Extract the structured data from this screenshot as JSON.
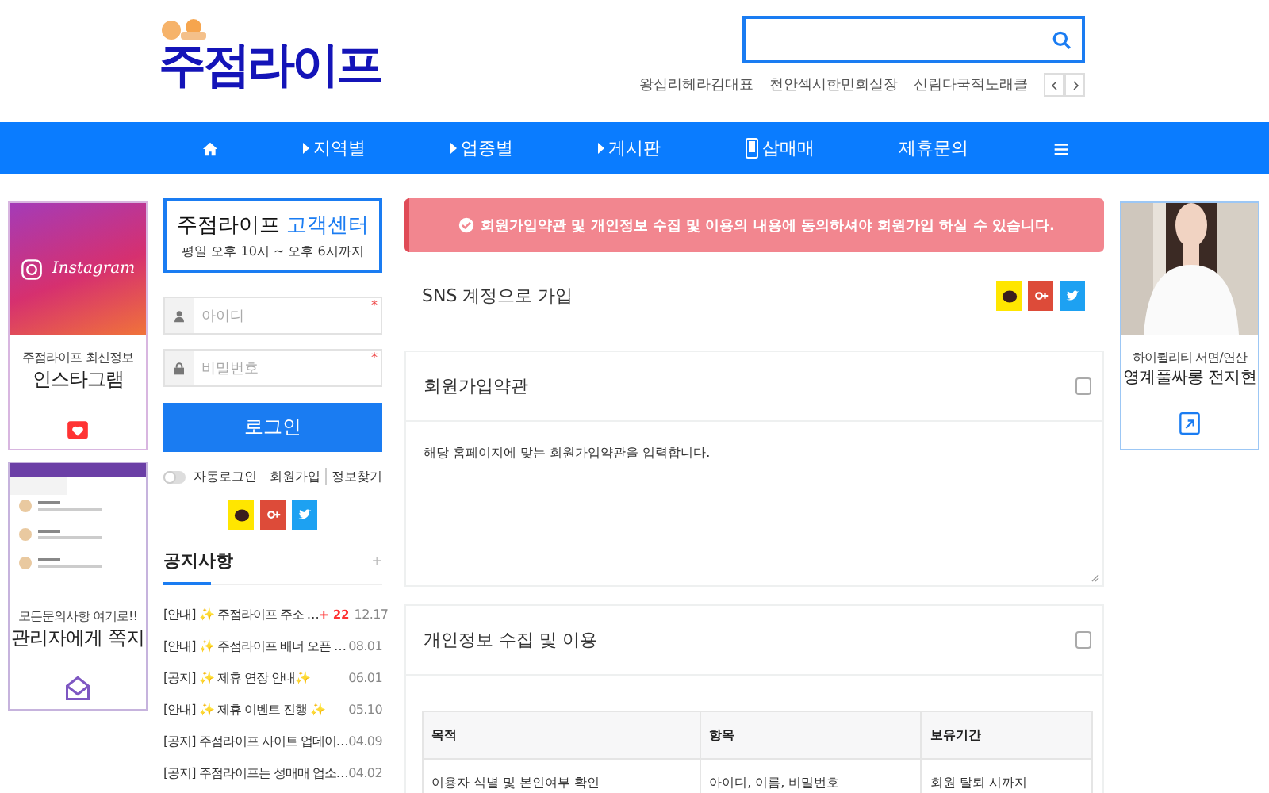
{
  "header": {
    "logo": "주점라이프",
    "keywords": [
      "왕십리헤라김대표",
      "천안섹시한민회실장",
      "신림다국적노래클"
    ]
  },
  "nav": [
    {
      "kind": "home"
    },
    {
      "kind": "caret",
      "label": "지역별"
    },
    {
      "kind": "caret",
      "label": "업종별"
    },
    {
      "kind": "caret",
      "label": "게시판"
    },
    {
      "kind": "phone",
      "label": "삽매매"
    },
    {
      "kind": "plain",
      "label": "제휴문의"
    },
    {
      "kind": "menu"
    }
  ],
  "left_banners": [
    {
      "kind": "instagram",
      "brand": "Instagram",
      "subtitle": "주점라이프 최신정보",
      "title": "인스타그램"
    },
    {
      "kind": "message",
      "subtitle": "모든문의사항 여기로!!",
      "title": "관리자에게 쪽지"
    }
  ],
  "login": {
    "center_name": "주점라이프",
    "center_label": "고객센터",
    "hours": "평일 오후 10시 ~ 오후 6시까지",
    "id_placeholder": "아이디",
    "pw_placeholder": "비밀번호",
    "required_mark": "*",
    "button": "로그인",
    "auto_login": {
      "label": "자동로그인",
      "on": false
    },
    "links": [
      "회원가입",
      "정보찾기"
    ]
  },
  "notices": {
    "title": "공지사항",
    "more": "+",
    "items": [
      {
        "tag": "[안내]",
        "title": "✨ 주점라이프 주소 …",
        "badge": "+ 22",
        "date": "12.17"
      },
      {
        "tag": "[안내]",
        "title": "✨ 주점라이프 배너 오픈 …",
        "date": "08.01"
      },
      {
        "tag": "[공지]",
        "title": "✨ 제휴 연장 안내✨",
        "date": "06.01"
      },
      {
        "tag": "[안내]",
        "title": "✨ 제휴 이벤트 진행 ✨",
        "date": "05.10"
      },
      {
        "tag": "[공지]",
        "title": "주점라이프 사이트 업데이…",
        "date": "04.09"
      },
      {
        "tag": "[공지]",
        "title": "주점라이프는 성매매 업소…",
        "date": "04.02"
      }
    ]
  },
  "alert": "회원가입약관 및 개인정보 수집 및 이용의 내용에 동의하셔야 회원가입 하실 수 있습니다.",
  "sns_join": "SNS 계정으로 가입",
  "terms": {
    "title": "회원가입약관",
    "checked": false,
    "text": "해당 홈페이지에 맞는 회원가입약관을 입력합니다."
  },
  "privacy": {
    "title": "개인정보 수집 및 이용",
    "checked": false,
    "columns": [
      "목적",
      "항목",
      "보유기간"
    ],
    "rows": [
      [
        "이용자 식별 및 본인여부 확인",
        "아이디, 이름, 비밀번호",
        "회원 탈퇴 시까지"
      ]
    ]
  },
  "right_banner": {
    "kind": "picture",
    "subtitle": "하이퀄리티 서면/연산",
    "title": "영계풀싸롱 전지현"
  }
}
